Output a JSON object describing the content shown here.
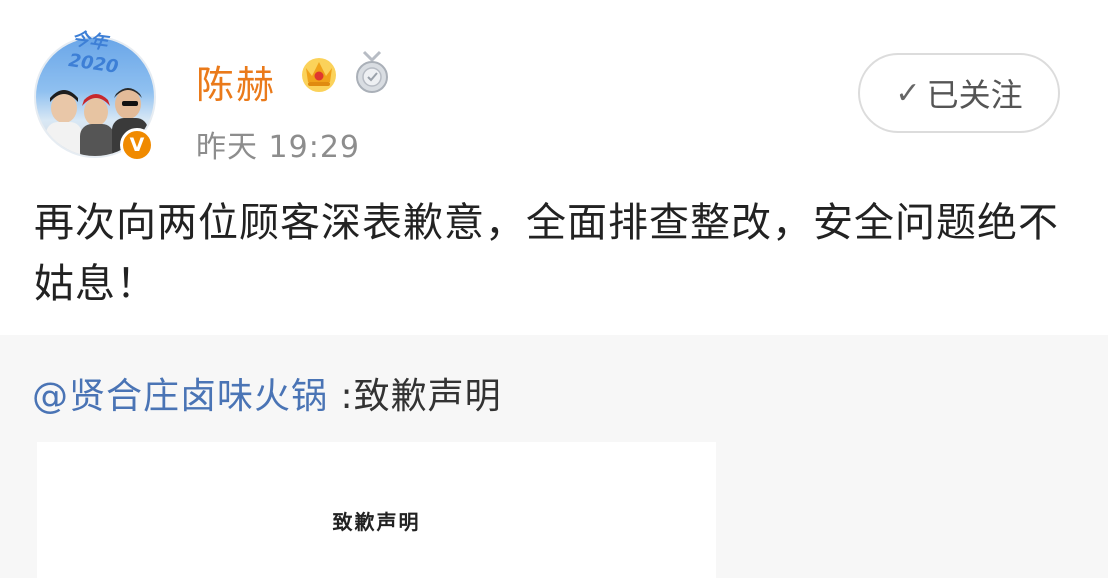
{
  "post": {
    "avatar": {
      "caption": "今年2020",
      "badge": "V",
      "badge_color": "#f08a00"
    },
    "author": {
      "name": "陈赫",
      "name_color": "#ea7a1a",
      "badges": [
        "crown-icon",
        "medal-icon"
      ]
    },
    "timestamp": "昨天 19:29",
    "follow_button": {
      "check": "✓",
      "label": "已关注"
    },
    "text": "再次向两位顾客深表歉意，全面排查整改，安全问题绝不姑息！"
  },
  "repost": {
    "mention": "@贤合庄卤味火锅",
    "rest": " :致歉声明",
    "image": {
      "doc_title": "致歉声明"
    }
  }
}
